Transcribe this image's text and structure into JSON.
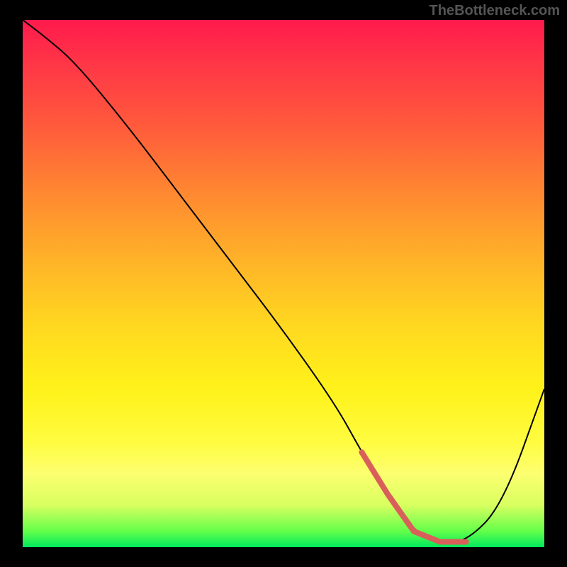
{
  "watermark": "TheBottleneck.com",
  "chart_data": {
    "type": "line",
    "title": "",
    "xlabel": "",
    "ylabel": "",
    "xlim": [
      0,
      100
    ],
    "ylim": [
      0,
      100
    ],
    "grid": false,
    "legend": false,
    "series": [
      {
        "name": "bottleneck-curve",
        "x": [
          0,
          4,
          10,
          20,
          30,
          40,
          50,
          60,
          65,
          70,
          75,
          80,
          85,
          92,
          100
        ],
        "y": [
          100,
          97,
          92,
          80,
          67,
          54,
          41,
          27,
          18,
          10,
          3,
          1,
          1,
          8,
          30
        ]
      }
    ],
    "highlight_range_x": [
      65,
      85
    ],
    "gradient_stops": [
      {
        "pos": 0,
        "color": "#ff1a4d"
      },
      {
        "pos": 20,
        "color": "#ff5a3c"
      },
      {
        "pos": 46,
        "color": "#ffb428"
      },
      {
        "pos": 70,
        "color": "#fff21a"
      },
      {
        "pos": 92,
        "color": "#d8ff60"
      },
      {
        "pos": 100,
        "color": "#00e85c"
      }
    ]
  }
}
